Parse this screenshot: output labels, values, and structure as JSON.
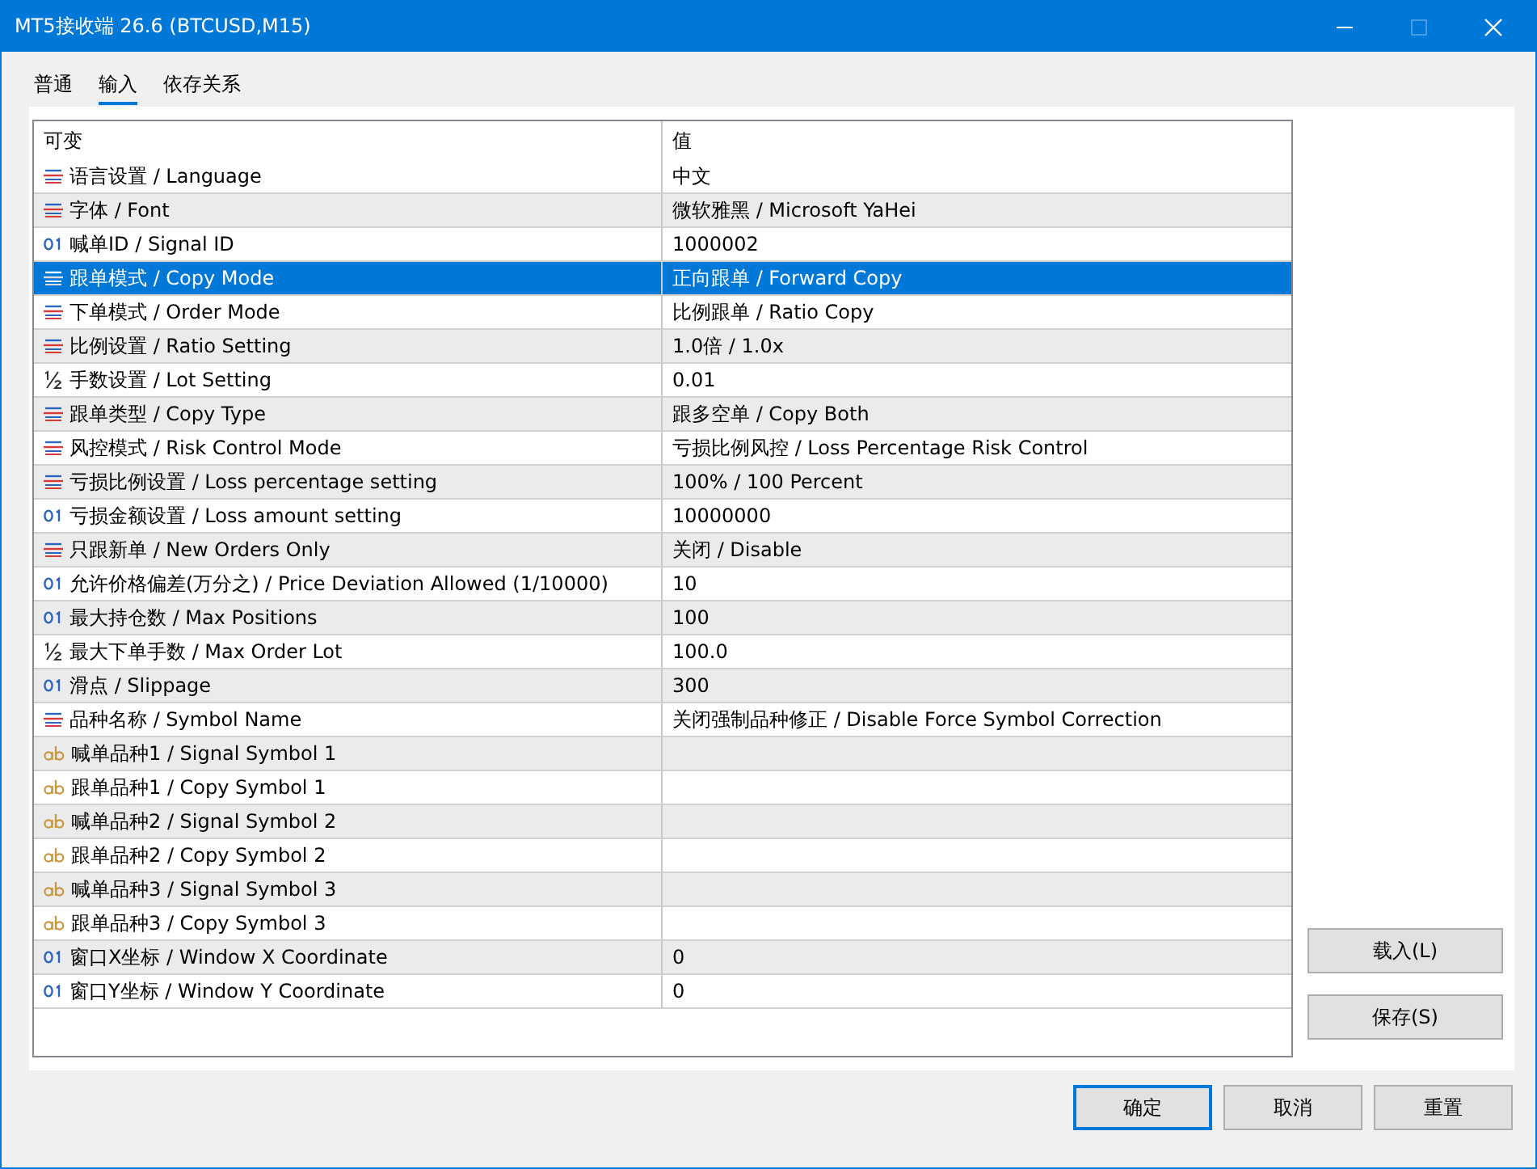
{
  "window": {
    "title": "MT5接收端 26.6 (BTCUSD,M15)"
  },
  "tabs": [
    {
      "label": "普通",
      "selected": false
    },
    {
      "label": "输入",
      "selected": true
    },
    {
      "label": "依存关系",
      "selected": false
    }
  ],
  "table": {
    "columns": [
      "可变",
      "值"
    ],
    "rows": [
      {
        "kind": "enum",
        "name": "语言设置 / Language",
        "value": "中文",
        "selected": false
      },
      {
        "kind": "enum",
        "name": "字体 / Font",
        "value": "微软雅黑 / Microsoft YaHei",
        "selected": false
      },
      {
        "kind": "int",
        "name": "喊单ID / Signal ID",
        "value": "1000002",
        "selected": false
      },
      {
        "kind": "enum",
        "name": "跟单模式 / Copy Mode",
        "value": "正向跟单 / Forward Copy",
        "selected": true
      },
      {
        "kind": "enum",
        "name": "下单模式 / Order Mode",
        "value": "比例跟单 / Ratio Copy",
        "selected": false
      },
      {
        "kind": "enum",
        "name": "比例设置 / Ratio Setting",
        "value": "1.0倍 / 1.0x",
        "selected": false
      },
      {
        "kind": "double",
        "name": "手数设置 / Lot Setting",
        "value": "0.01",
        "selected": false
      },
      {
        "kind": "enum",
        "name": "跟单类型 / Copy Type",
        "value": "跟多空单 / Copy Both",
        "selected": false
      },
      {
        "kind": "enum",
        "name": "风控模式 / Risk Control Mode",
        "value": "亏损比例风控 / Loss Percentage Risk Control",
        "selected": false
      },
      {
        "kind": "enum",
        "name": "亏损比例设置 / Loss percentage setting",
        "value": "100% / 100 Percent",
        "selected": false
      },
      {
        "kind": "int",
        "name": "亏损金额设置 / Loss amount setting",
        "value": "10000000",
        "selected": false
      },
      {
        "kind": "enum",
        "name": "只跟新单 / New Orders Only",
        "value": "关闭 / Disable",
        "selected": false
      },
      {
        "kind": "int",
        "name": "允许价格偏差(万分之) / Price Deviation Allowed (1/10000)",
        "value": "10",
        "selected": false
      },
      {
        "kind": "int",
        "name": "最大持仓数 / Max Positions",
        "value": "100",
        "selected": false
      },
      {
        "kind": "double",
        "name": "最大下单手数 / Max Order Lot",
        "value": "100.0",
        "selected": false
      },
      {
        "kind": "int",
        "name": "滑点 / Slippage",
        "value": "300",
        "selected": false
      },
      {
        "kind": "enum",
        "name": "品种名称 / Symbol Name",
        "value": "关闭强制品种修正 / Disable Force Symbol Correction",
        "selected": false
      },
      {
        "kind": "string",
        "name": "喊单品种1 / Signal Symbol 1",
        "selected": false
      },
      {
        "kind": "string",
        "name": "跟单品种1 / Copy Symbol 1",
        "selected": false
      },
      {
        "kind": "string",
        "name": "喊单品种2 / Signal Symbol 2",
        "selected": false
      },
      {
        "kind": "string",
        "name": "跟单品种2 / Copy Symbol 2",
        "selected": false
      },
      {
        "kind": "string",
        "name": "喊单品种3 / Signal Symbol 3",
        "selected": false
      },
      {
        "kind": "string",
        "name": "跟单品种3 / Copy Symbol 3",
        "selected": false
      },
      {
        "kind": "int",
        "name": "窗口X坐标 / Window X Coordinate",
        "value": "0",
        "selected": false
      },
      {
        "kind": "int",
        "name": "窗口Y坐标 / Window Y Coordinate",
        "value": "0",
        "selected": false
      }
    ]
  },
  "side_buttons": [
    "载入(L)",
    "保存(S)"
  ],
  "buttons": [
    {
      "label": "确定",
      "default": true
    },
    {
      "label": "取消",
      "default": false
    },
    {
      "label": "重置",
      "default": false
    }
  ]
}
